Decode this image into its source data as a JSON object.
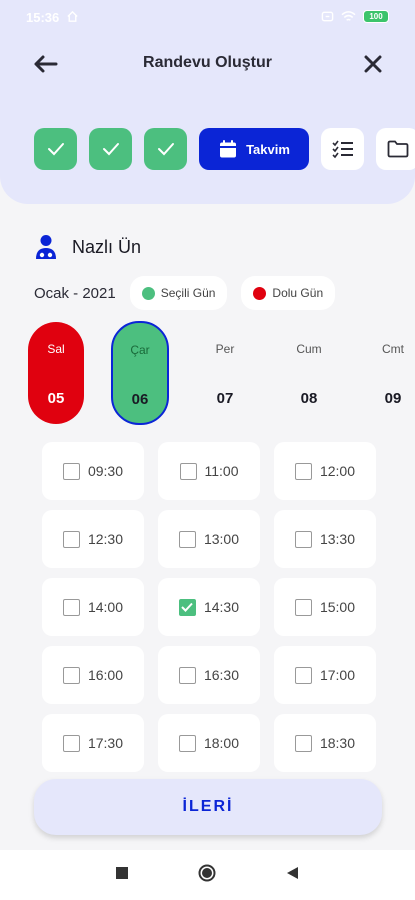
{
  "status_bar": {
    "time": "15:36",
    "battery": "100"
  },
  "header": {
    "title": "Randevu Oluştur"
  },
  "steps": {
    "active_label": "Takvim"
  },
  "doctor": {
    "name": "Nazlı Ün"
  },
  "calendar": {
    "month": "Ocak - 2021",
    "legend": {
      "selected": "Seçili Gün",
      "busy": "Dolu Gün"
    },
    "days": [
      {
        "name": "Sal",
        "date": "05",
        "state": "busy"
      },
      {
        "name": "Çar",
        "date": "06",
        "state": "selected"
      },
      {
        "name": "Per",
        "date": "07",
        "state": "free"
      },
      {
        "name": "Cum",
        "date": "08",
        "state": "free"
      },
      {
        "name": "Cmt",
        "date": "09",
        "state": "free"
      }
    ]
  },
  "slots": [
    {
      "time": "09:30",
      "checked": false
    },
    {
      "time": "11:00",
      "checked": false
    },
    {
      "time": "12:00",
      "checked": false
    },
    {
      "time": "12:30",
      "checked": false
    },
    {
      "time": "13:00",
      "checked": false
    },
    {
      "time": "13:30",
      "checked": false
    },
    {
      "time": "14:00",
      "checked": false
    },
    {
      "time": "14:30",
      "checked": true
    },
    {
      "time": "15:00",
      "checked": false
    },
    {
      "time": "16:00",
      "checked": false
    },
    {
      "time": "16:30",
      "checked": false
    },
    {
      "time": "17:00",
      "checked": false
    },
    {
      "time": "17:30",
      "checked": false
    },
    {
      "time": "18:00",
      "checked": false
    },
    {
      "time": "18:30",
      "checked": false
    }
  ],
  "actions": {
    "next_label": "İLERİ"
  },
  "colors": {
    "accent": "#0b25d6",
    "success": "#4cbf7f",
    "busy": "#e0010f",
    "header_bg": "#e5e7fb"
  },
  "icons": {
    "back": "arrow-left-icon",
    "close": "close-icon",
    "calendar": "calendar-icon",
    "checklist": "checklist-icon",
    "folder": "folder-icon",
    "doctor": "doctor-icon"
  }
}
